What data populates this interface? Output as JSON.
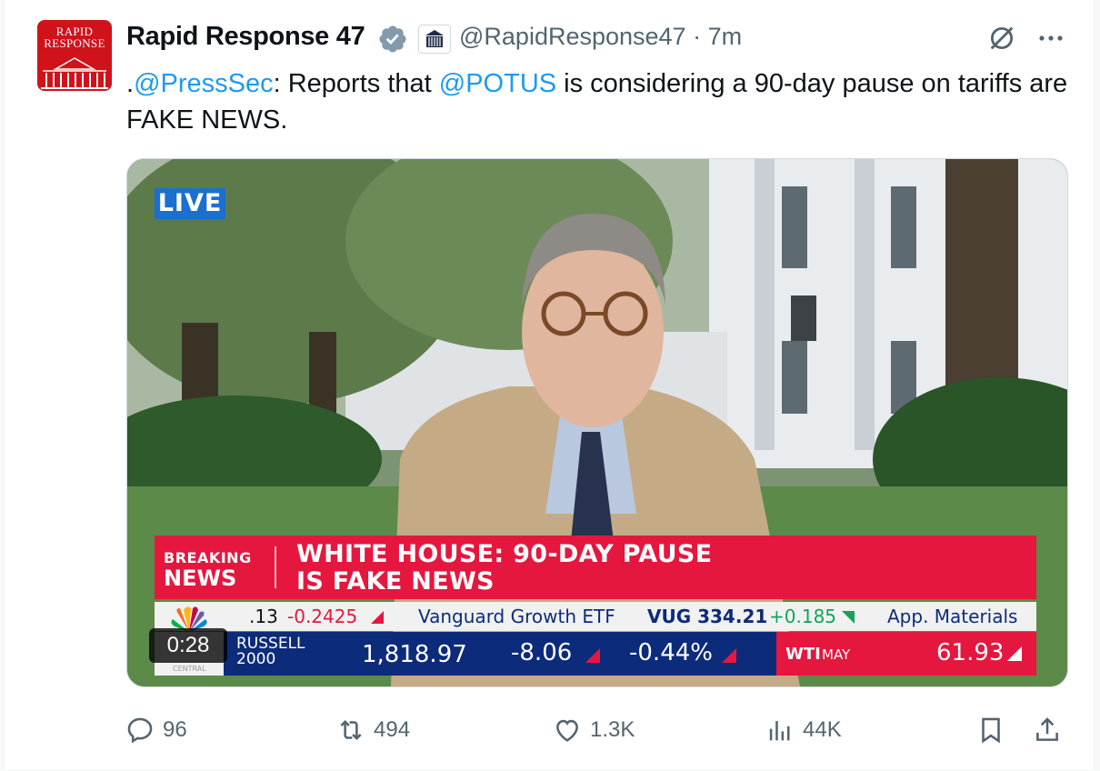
{
  "account": {
    "name": "Rapid Response 47",
    "handle": "@RapidResponse47",
    "separator": "·",
    "time": "7m",
    "avatar_text_line1": "RAPID",
    "avatar_text_line2": "RESPONSE"
  },
  "tweet": {
    "prefix": ".",
    "mention1": "@PressSec",
    "text1": ": Reports that ",
    "mention2": "@POTUS",
    "text2": " is considering a 90-day pause on tariffs are FAKE NEWS."
  },
  "video": {
    "live_label": "LIVE",
    "timestamp": "0:28",
    "breaking_line1": "BREAKING",
    "breaking_line2": "NEWS",
    "headline_line1": "WHITE HOUSE: 90-DAY PAUSE",
    "headline_line2": "IS FAKE NEWS",
    "ticker_top": {
      "prev_value": ".13",
      "prev_change": "-0.2425",
      "mid_label": "Vanguard Growth ETF",
      "mid_symbol": "VUG 334.21",
      "mid_change": "+0.185",
      "next_label": "App. Materials"
    },
    "ticker_bottom": {
      "index_line1": "RUSSELL",
      "index_line2": "2000",
      "value": "1,818.97",
      "change": "-8.06",
      "pct": "-0.44%",
      "wti_label": "WTI",
      "wti_month": "MAY",
      "wti_value": "61.93"
    },
    "network_label": "CENTRAL"
  },
  "actions": {
    "replies": "96",
    "reposts": "494",
    "likes": "1.3K",
    "views": "44K"
  },
  "colors": {
    "link": "#1d9bf0",
    "muted": "#536471",
    "breaking_red": "#e5173f",
    "ticker_blue": "#0c2b7a",
    "verified_gray": "#829aab"
  }
}
